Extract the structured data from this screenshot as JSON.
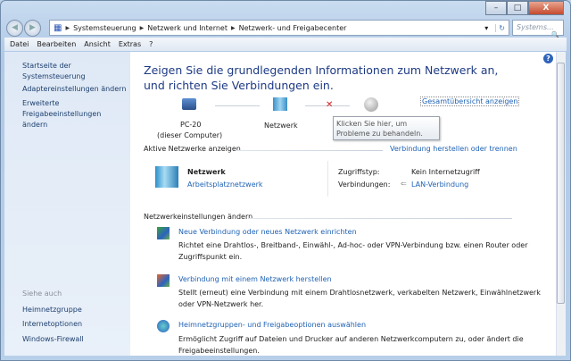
{
  "window": {
    "minimize": "–",
    "maximize": "□",
    "close": "X"
  },
  "nav": {
    "back": "◀",
    "forward": "▶"
  },
  "address": {
    "crumbs": [
      "Systemsteuerung",
      "Netzwerk und Internet",
      "Netzwerk- und Freigabecenter"
    ],
    "dropdown": "▾",
    "refresh": "↻"
  },
  "search": {
    "placeholder": "Systems...",
    "icon": "🔍"
  },
  "menu": [
    "Datei",
    "Bearbeiten",
    "Ansicht",
    "Extras",
    "?"
  ],
  "sidebar": {
    "home": "Startseite der Systemsteuerung",
    "items": [
      "Adaptereinstellungen ändern",
      "Erweiterte Freigabeeinstellungen ändern"
    ],
    "see_also": "Siehe auch",
    "see_also_items": [
      "Heimnetzgruppe",
      "Internetoptionen",
      "Windows-Firewall"
    ]
  },
  "main": {
    "heading": "Zeigen Sie die grundlegenden Informationen zum Netzwerk an, und richten Sie Verbindungen ein.",
    "full_map": "Gesamtübersicht anzeigen",
    "map": {
      "pc": "PC-20",
      "pc_sub": "(dieser Computer)",
      "network": "Netzwerk",
      "tooltip": "Klicken Sie hier, um Probleme zu behandeln.",
      "error": "✕"
    },
    "active_title": "Aktive Netzwerke anzeigen",
    "connect_link": "Verbindung herstellen oder trennen",
    "network": {
      "name": "Netzwerk",
      "type": "Arbeitsplatznetzwerk",
      "access_label": "Zugriffstyp:",
      "access_value": "Kein Internetzugriff",
      "conn_label": "Verbindungen:",
      "conn_value": "LAN-Verbindung"
    },
    "settings_title": "Netzwerkeinstellungen ändern",
    "tasks": [
      {
        "title": "Neue Verbindung oder neues Netzwerk einrichten",
        "desc": "Richtet eine Drahtlos-, Breitband-, Einwähl-, Ad-hoc- oder VPN-Verbindung bzw. einen Router oder Zugriffspunkt ein."
      },
      {
        "title": "Verbindung mit einem Netzwerk herstellen",
        "desc": "Stellt (erneut) eine Verbindung mit einem Drahtlosnetzwerk, verkabelten Netzwerk, Einwählnetzwerk oder VPN-Netzwerk her."
      },
      {
        "title": "Heimnetzgruppen- und Freigabeoptionen auswählen",
        "desc": "Ermöglicht Zugriff auf Dateien und Drucker auf anderen Netzwerkcomputern zu, oder ändert die Freigabeeinstellungen."
      }
    ],
    "help": "?"
  }
}
